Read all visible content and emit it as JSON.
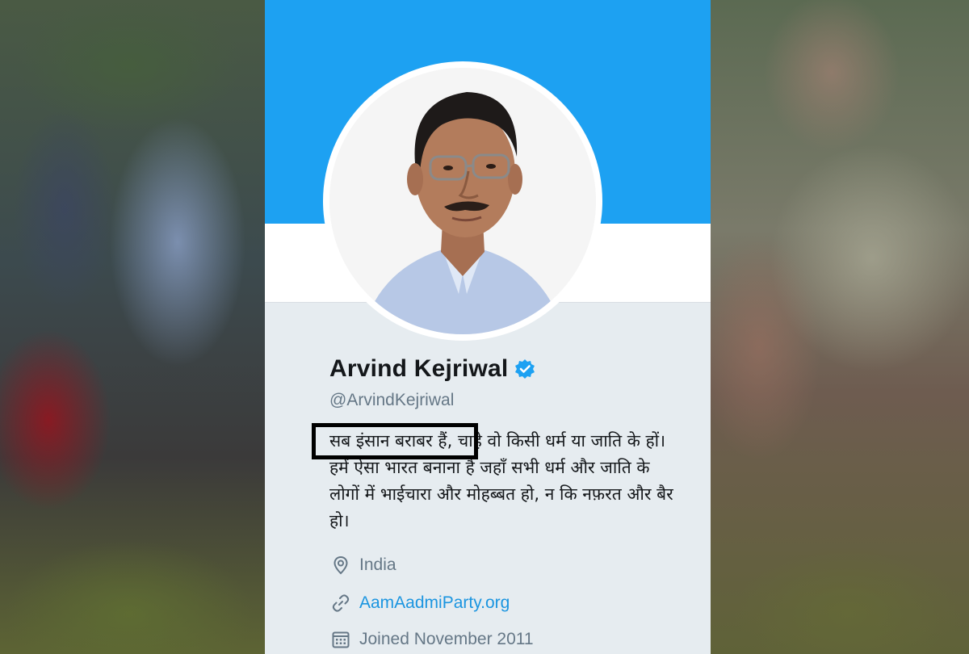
{
  "profile": {
    "name": "Arvind Kejriwal",
    "handle": "@ArvindKejriwal",
    "bio": "सब इंसान बराबर हैं, चाहे वो किसी धर्म या जाति के हों। हमें ऐसा भारत बनाना है जहाँ सभी धर्म और जाति के लोगों में भाईचारा और मोहब्बत हो, न कि नफ़रत और बैर हो।",
    "location": "India",
    "website": "AamAadmiParty.org",
    "joined": "Joined November 2011"
  },
  "icons": {
    "verified": "verified-badge-icon",
    "location": "location-pin-icon",
    "website": "link-icon",
    "joined": "calendar-icon"
  },
  "colors": {
    "banner": "#1da1f2",
    "card_background": "#e6ecf0",
    "link": "#1b95e0",
    "muted_text": "#657786",
    "highlight_border": "#000000"
  }
}
